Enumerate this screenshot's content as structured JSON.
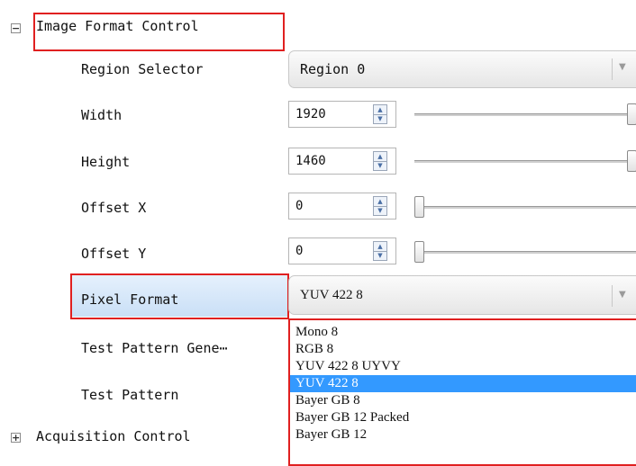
{
  "categories": {
    "image_format": {
      "label": "Image Format Control",
      "toggle": "⊟"
    },
    "acquisition": {
      "label": "Acquisition Control",
      "toggle": "⊞"
    }
  },
  "rows": {
    "region_selector": {
      "label": "Region Selector",
      "value": "Region 0"
    },
    "width": {
      "label": "Width",
      "value": "1920",
      "slider_fraction": 1.0
    },
    "height": {
      "label": "Height",
      "value": "1460",
      "slider_fraction": 1.0
    },
    "offset_x": {
      "label": "Offset X",
      "value": "0",
      "slider_fraction": 0.0
    },
    "offset_y": {
      "label": "Offset Y",
      "value": "0",
      "slider_fraction": 0.0
    },
    "pixel_format": {
      "label": "Pixel Format",
      "value": "YUV 422 8"
    },
    "test_pattern_gen": {
      "label": "Test Pattern Gene⋯"
    },
    "test_pattern": {
      "label": "Test Pattern"
    }
  },
  "pixel_format_options": [
    "Mono 8",
    "RGB 8",
    "YUV 422 8 UYVY",
    "YUV 422 8",
    "Bayer GB 8",
    "Bayer GB 12 Packed",
    "Bayer GB 12"
  ],
  "selected_option": "YUV 422 8",
  "colors": {
    "highlight": "#3399ff",
    "annotation_red": "#e02020",
    "selected_row_bg": "#c9dff6"
  }
}
